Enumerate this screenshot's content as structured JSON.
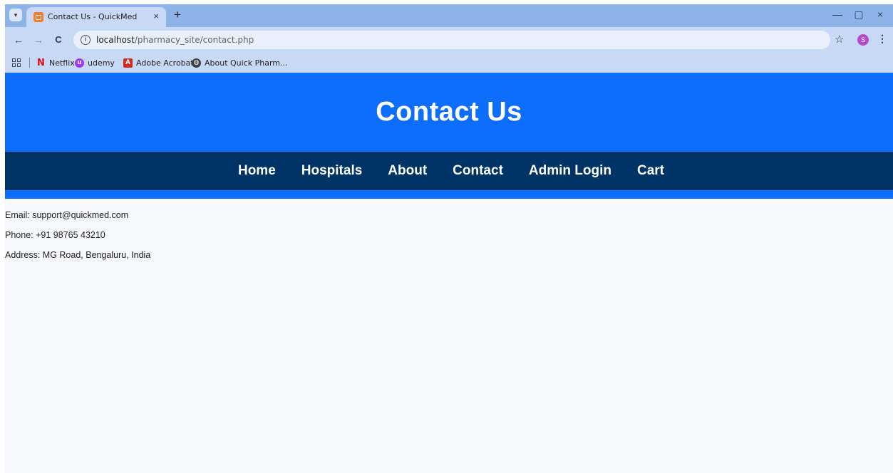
{
  "browser": {
    "tab": {
      "title": "Contact Us - QuickMed",
      "close": "×"
    },
    "new_tab": "+",
    "window_controls": {
      "minimize": "—",
      "restore": "▢",
      "close": "×"
    },
    "nav": {
      "back": "←",
      "forward": "→",
      "reload": "C"
    },
    "address": {
      "host": "localhost",
      "path": "/pharmacy_site/contact.php"
    },
    "profile_initial": "S",
    "bookmarks": [
      {
        "label": "Netflix",
        "icon": "netflix-icon",
        "color": "#e50914"
      },
      {
        "label": "udemy",
        "icon": "udemy-icon",
        "color": "#a435f0"
      },
      {
        "label": "Adobe Acrobat",
        "icon": "acrobat-icon",
        "color": "#d7281f"
      },
      {
        "label": "About Quick Pharm...",
        "icon": "globe-icon",
        "color": "#3c4043"
      }
    ]
  },
  "page": {
    "title": "Contact Us",
    "nav": [
      "Home",
      "Hospitals",
      "About",
      "Contact",
      "Admin Login",
      "Cart"
    ],
    "contact": {
      "email": "Email: support@quickmed.com",
      "phone": "Phone: +91 98765 43210",
      "address": "Address: MG Road, Bengaluru, India"
    }
  },
  "colors": {
    "hero": "#0d6efd",
    "navbar": "#003366",
    "page_background": "#f6f8fb"
  }
}
